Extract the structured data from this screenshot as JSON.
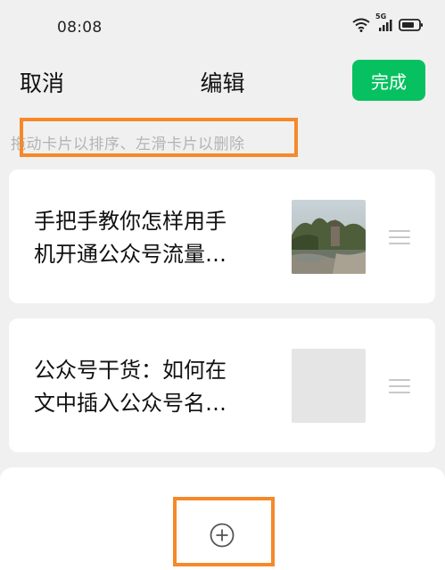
{
  "status_bar": {
    "time": "08:08",
    "network_label": "5G",
    "icons": [
      "wifi-icon",
      "signal-icon",
      "battery-icon"
    ]
  },
  "nav": {
    "cancel_label": "取消",
    "title": "编辑",
    "done_label": "完成"
  },
  "hint": "拖动卡片以排序、左滑卡片以删除",
  "cards": [
    {
      "title_line1": "手把手教你怎样用手",
      "title_line2": "机开通公众号流量…",
      "thumbnail": "garden-photo"
    },
    {
      "title_line1": "公众号干货：如何在",
      "title_line2": "文中插入公众号名…",
      "thumbnail": "placeholder"
    }
  ],
  "add_button_icon": "add-circle-icon",
  "colors": {
    "accent": "#07c160",
    "highlight": "#f5892a",
    "background": "#f0f0f0",
    "hint": "#b4b4b4"
  }
}
